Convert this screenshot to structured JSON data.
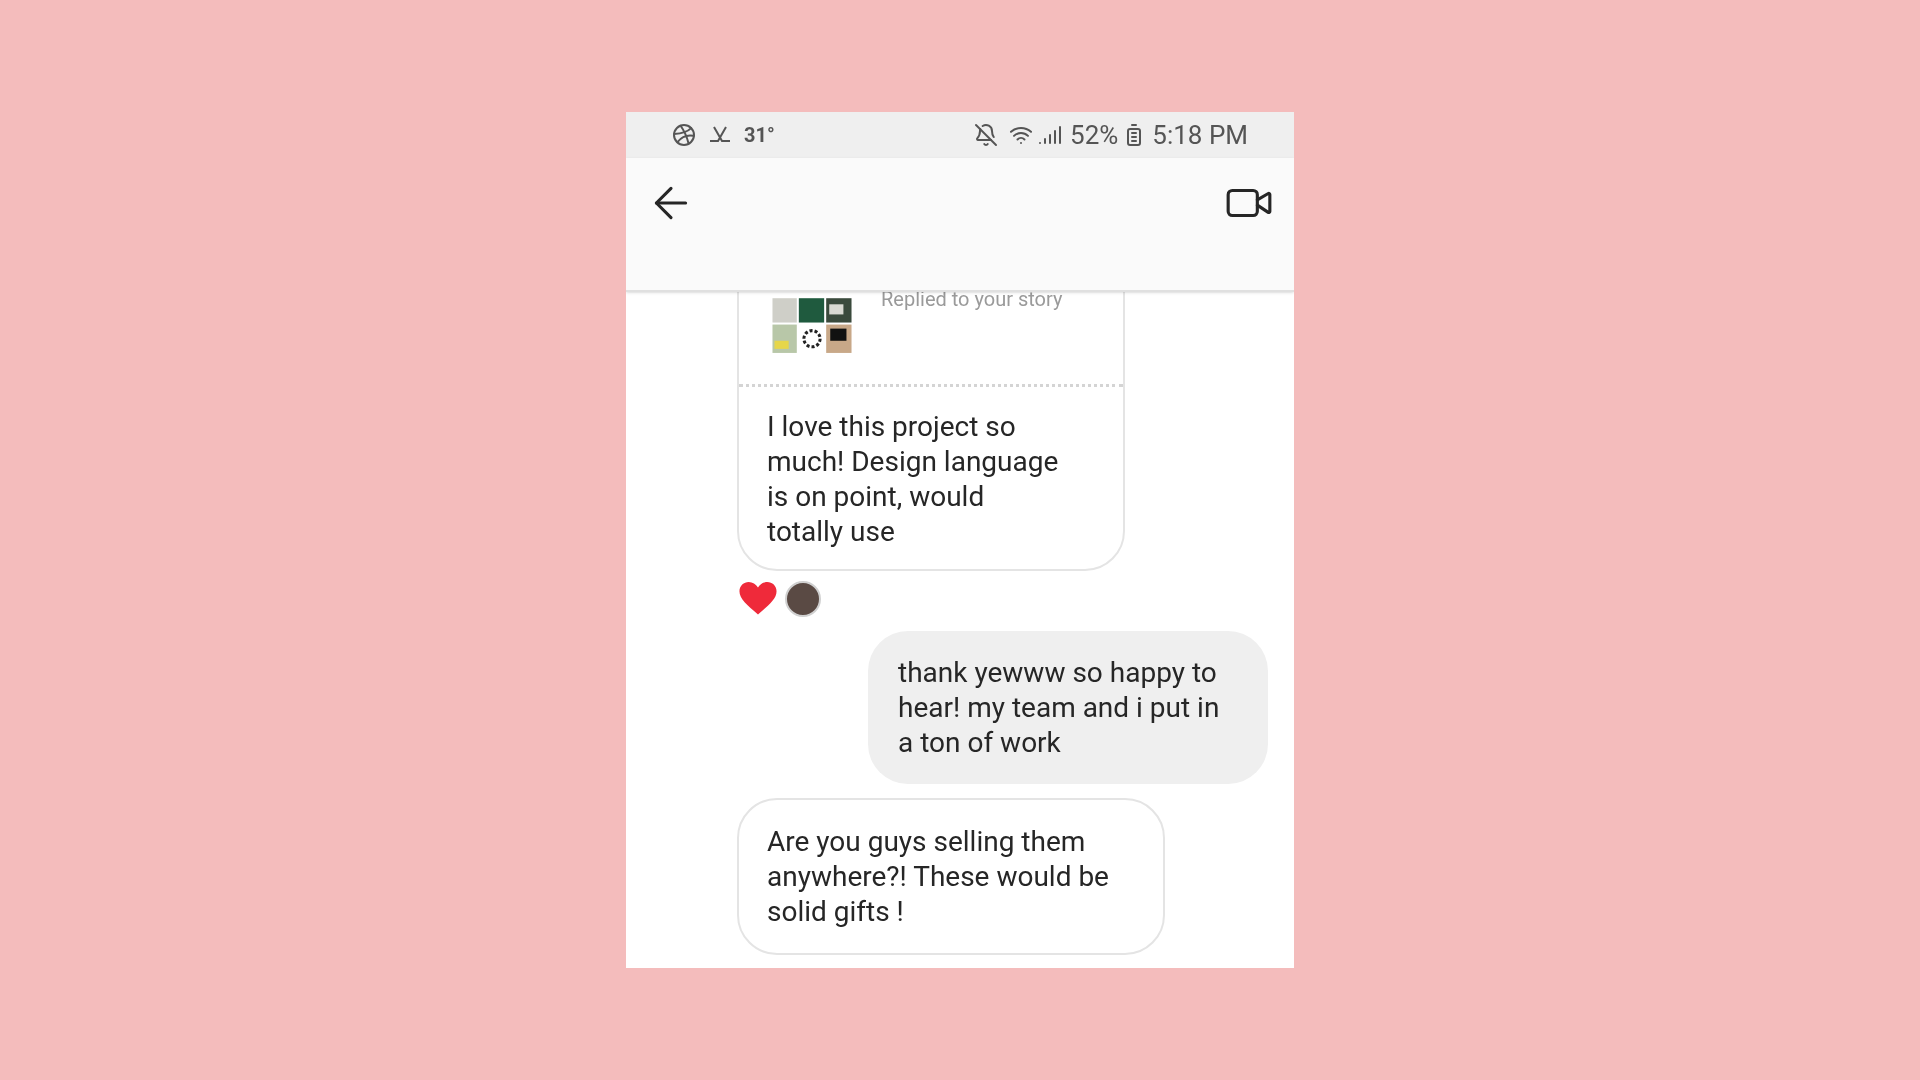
{
  "status_bar": {
    "temperature": "31°",
    "battery": "52%",
    "time": "5:18 PM"
  },
  "messages": [
    {
      "kind": "story_reply",
      "sent": false,
      "caption": "Replied to your story",
      "text": "I love this project so much! Design language is on point, would totally use",
      "reactions": [
        {
          "kind": "heart"
        },
        {
          "kind": "avatar"
        }
      ]
    },
    {
      "kind": "text",
      "sent": true,
      "text": "thank yewww so happy to hear! my team and i put in a ton of work"
    },
    {
      "kind": "text",
      "sent": false,
      "text": "Are you guys selling them anywhere?! These would be solid gifts !"
    }
  ]
}
